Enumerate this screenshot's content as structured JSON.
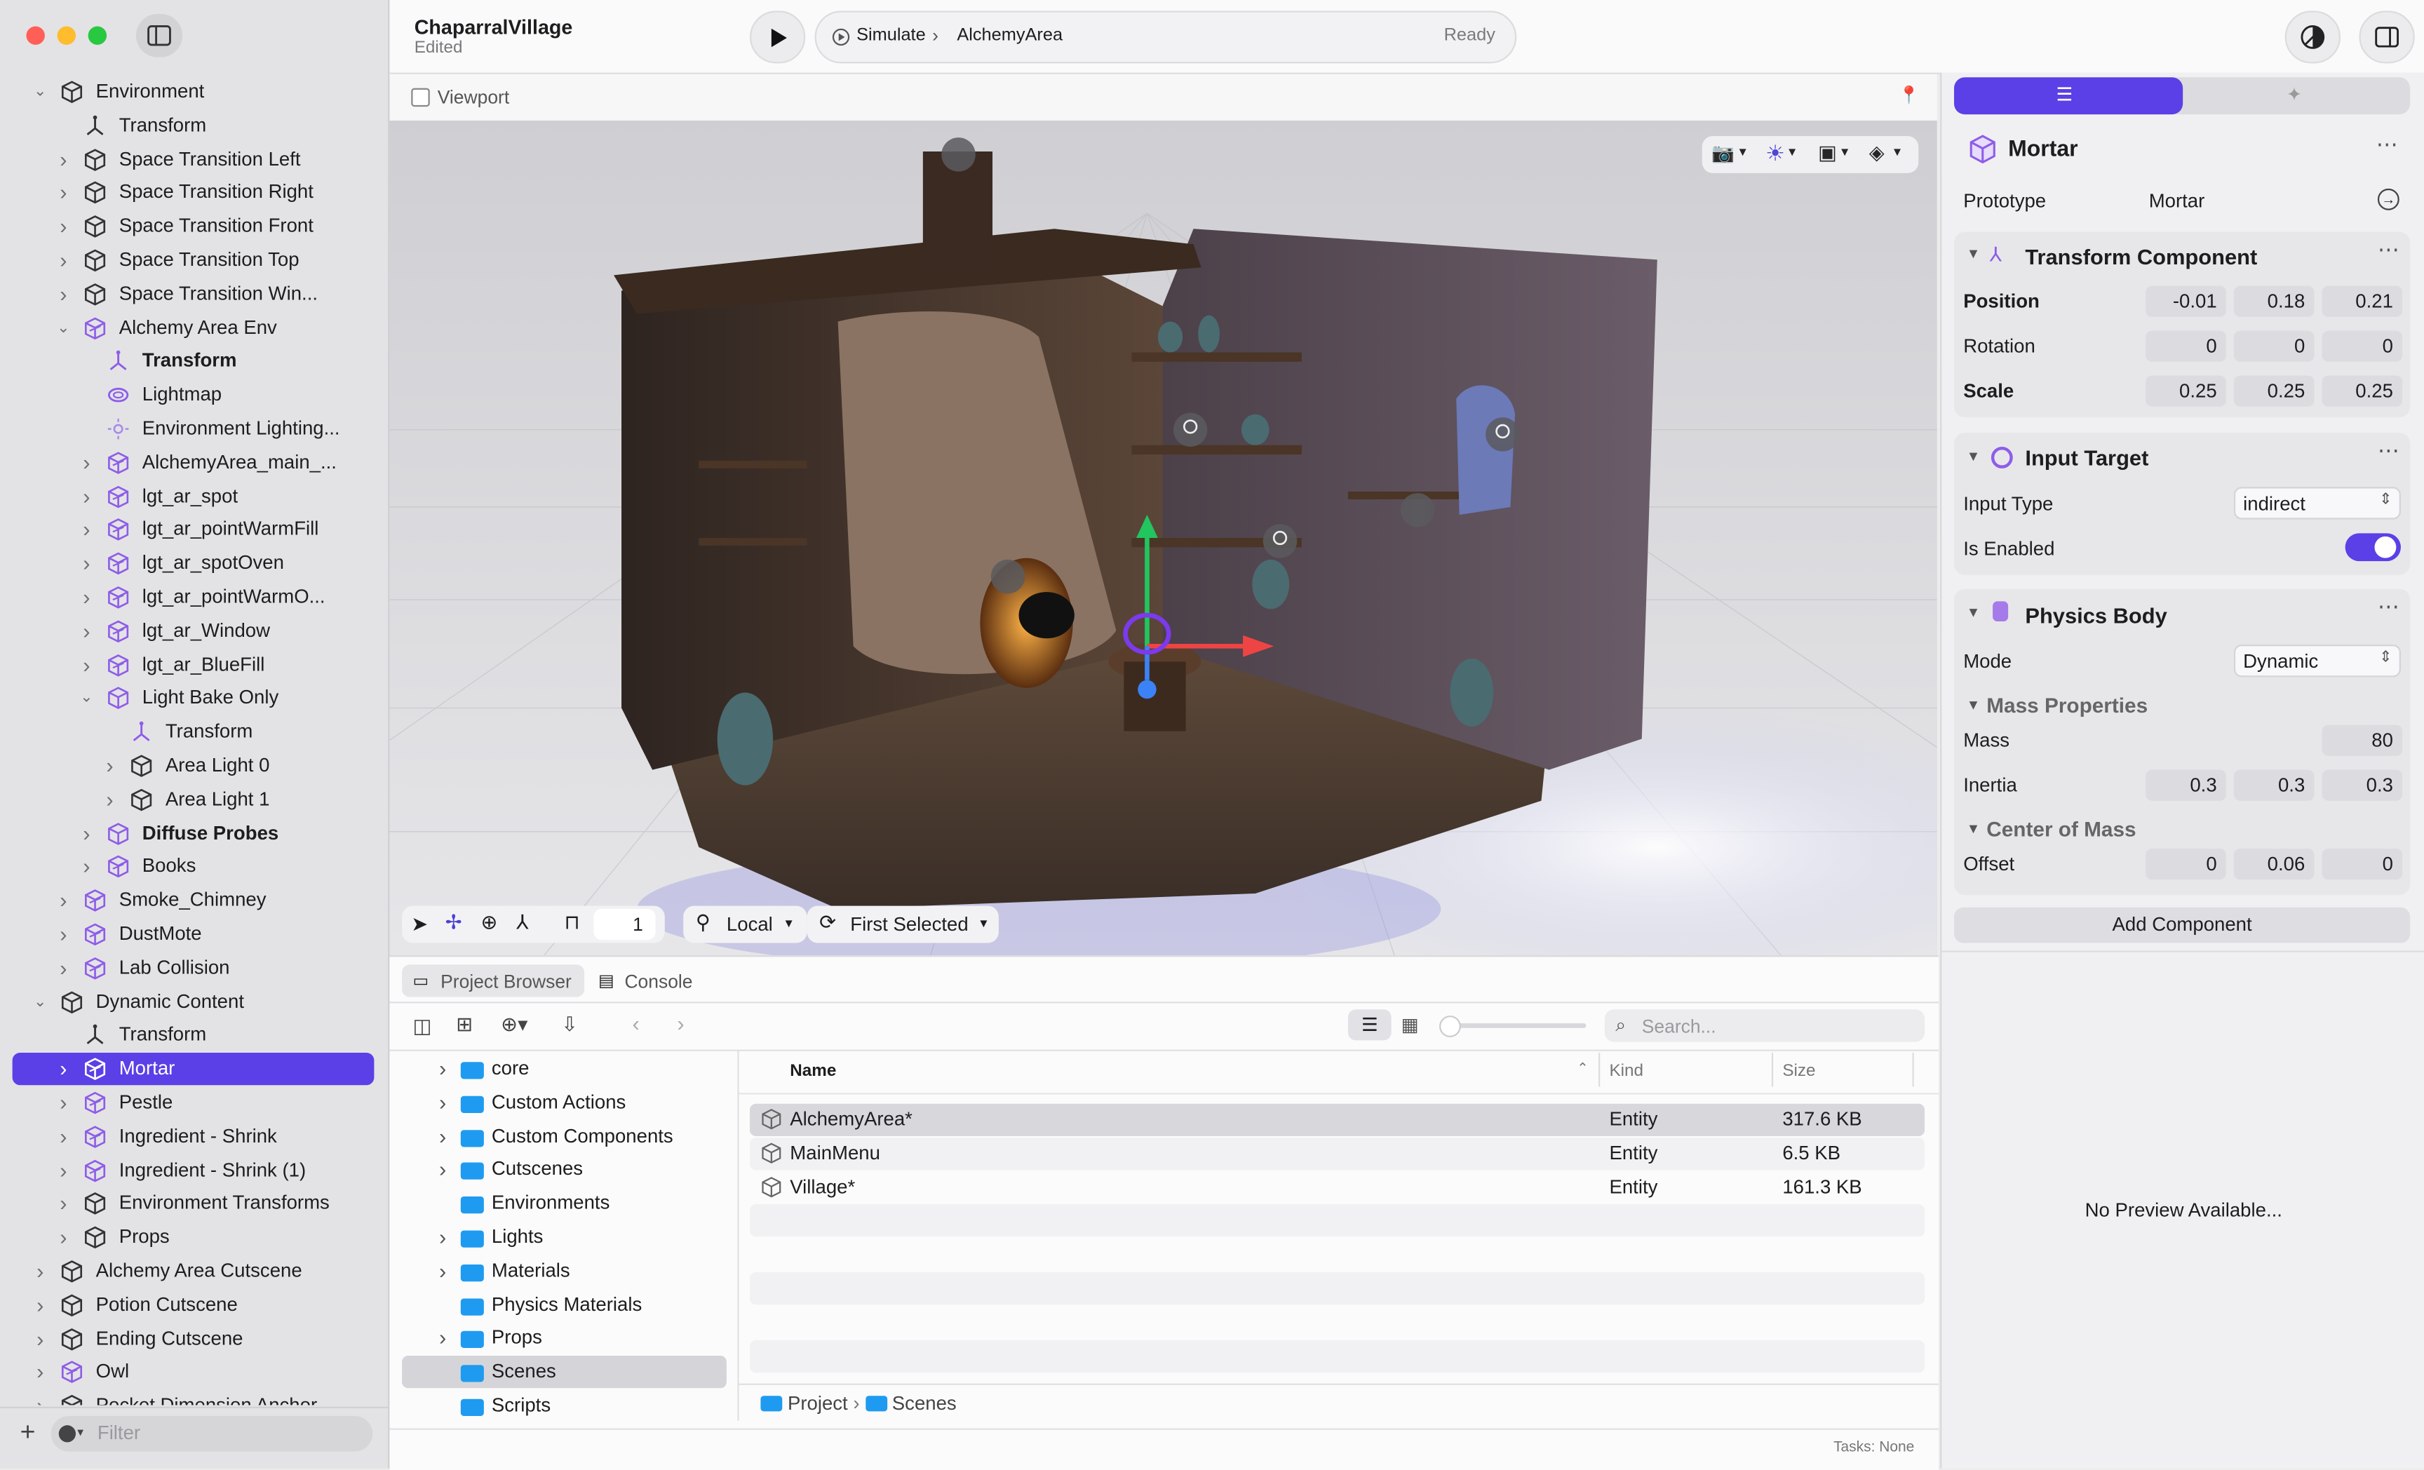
{
  "project": {
    "name": "ChaparralVillage",
    "status": "Edited"
  },
  "toolbar": {
    "simulate_label": "Simulate",
    "scene": "AlchemyArea",
    "state": "Ready"
  },
  "viewport": {
    "title": "Viewport",
    "space": "Local",
    "pivot": "First Selected",
    "snap_count": "1"
  },
  "hierarchy": [
    {
      "label": "Environment",
      "depth": 0,
      "chev": "down",
      "icon": "box"
    },
    {
      "label": "Transform",
      "depth": 1,
      "chev": "none",
      "icon": "axes"
    },
    {
      "label": "Space Transition Left",
      "depth": 1,
      "chev": "right",
      "icon": "box"
    },
    {
      "label": "Space Transition Right",
      "depth": 1,
      "chev": "right",
      "icon": "box"
    },
    {
      "label": "Space Transition Front",
      "depth": 1,
      "chev": "right",
      "icon": "box"
    },
    {
      "label": "Space Transition Top",
      "depth": 1,
      "chev": "right",
      "icon": "box"
    },
    {
      "label": "Space Transition Win...",
      "depth": 1,
      "chev": "right",
      "icon": "box"
    },
    {
      "label": "Alchemy Area Env",
      "depth": 1,
      "chev": "down",
      "icon": "proto"
    },
    {
      "label": "Transform",
      "depth": 2,
      "chev": "none",
      "icon": "axes-p",
      "bold": true
    },
    {
      "label": "Lightmap",
      "depth": 2,
      "chev": "none",
      "icon": "ring"
    },
    {
      "label": "Environment Lighting...",
      "depth": 2,
      "chev": "none",
      "icon": "sun"
    },
    {
      "label": "AlchemyArea_main_...",
      "depth": 2,
      "chev": "right",
      "icon": "proto"
    },
    {
      "label": "lgt_ar_spot",
      "depth": 2,
      "chev": "right",
      "icon": "proto"
    },
    {
      "label": "lgt_ar_pointWarmFill",
      "depth": 2,
      "chev": "right",
      "icon": "proto"
    },
    {
      "label": "lgt_ar_spotOven",
      "depth": 2,
      "chev": "right",
      "icon": "proto"
    },
    {
      "label": "lgt_ar_pointWarmO...",
      "depth": 2,
      "chev": "right",
      "icon": "proto"
    },
    {
      "label": "lgt_ar_Window",
      "depth": 2,
      "chev": "right",
      "icon": "proto"
    },
    {
      "label": "lgt_ar_BlueFill",
      "depth": 2,
      "chev": "right",
      "icon": "proto"
    },
    {
      "label": "Light Bake Only",
      "depth": 2,
      "chev": "down",
      "icon": "boxp"
    },
    {
      "label": "Transform",
      "depth": 3,
      "chev": "none",
      "icon": "axes-p"
    },
    {
      "label": "Area Light 0",
      "depth": 3,
      "chev": "right",
      "icon": "box"
    },
    {
      "label": "Area Light 1",
      "depth": 3,
      "chev": "right",
      "icon": "box"
    },
    {
      "label": "Diffuse Probes",
      "depth": 2,
      "chev": "right",
      "icon": "boxp",
      "bold": true
    },
    {
      "label": "Books",
      "depth": 2,
      "chev": "right",
      "icon": "proto"
    },
    {
      "label": "Smoke_Chimney",
      "depth": 1,
      "chev": "right",
      "icon": "proto"
    },
    {
      "label": "DustMote",
      "depth": 1,
      "chev": "right",
      "icon": "proto"
    },
    {
      "label": "Lab Collision",
      "depth": 1,
      "chev": "right",
      "icon": "proto"
    },
    {
      "label": "Dynamic Content",
      "depth": 0,
      "chev": "down",
      "icon": "box"
    },
    {
      "label": "Transform",
      "depth": 1,
      "chev": "none",
      "icon": "axes"
    },
    {
      "label": "Mortar",
      "depth": 1,
      "chev": "right",
      "icon": "proto",
      "selected": true
    },
    {
      "label": "Pestle",
      "depth": 1,
      "chev": "right",
      "icon": "proto"
    },
    {
      "label": "Ingredient - Shrink",
      "depth": 1,
      "chev": "right",
      "icon": "proto"
    },
    {
      "label": "Ingredient - Shrink (1)",
      "depth": 1,
      "chev": "right",
      "icon": "proto"
    },
    {
      "label": "Environment Transforms",
      "depth": 1,
      "chev": "right",
      "icon": "box"
    },
    {
      "label": "Props",
      "depth": 1,
      "chev": "right",
      "icon": "box"
    },
    {
      "label": "Alchemy Area Cutscene",
      "depth": 0,
      "chev": "right",
      "icon": "box"
    },
    {
      "label": "Potion Cutscene",
      "depth": 0,
      "chev": "right",
      "icon": "box"
    },
    {
      "label": "Ending Cutscene",
      "depth": 0,
      "chev": "right",
      "icon": "box"
    },
    {
      "label": "Owl",
      "depth": 0,
      "chev": "right",
      "icon": "proto"
    },
    {
      "label": "Pocket Dimension Anchor",
      "depth": 0,
      "chev": "right",
      "icon": "box"
    }
  ],
  "filter": {
    "placeholder": "Filter"
  },
  "inspector": {
    "entity_name": "Mortar",
    "prototype_label": "Prototype",
    "prototype_value": "Mortar",
    "transform": {
      "title": "Transform Component",
      "position_label": "Position",
      "position": [
        "-0.01",
        "0.18",
        "0.21"
      ],
      "rotation_label": "Rotation",
      "rotation": [
        "0",
        "0",
        "0"
      ],
      "scale_label": "Scale",
      "scale": [
        "0.25",
        "0.25",
        "0.25"
      ]
    },
    "input_target": {
      "title": "Input Target",
      "type_label": "Input Type",
      "type_value": "indirect",
      "enabled_label": "Is Enabled",
      "enabled": true
    },
    "physics": {
      "title": "Physics Body",
      "mode_label": "Mode",
      "mode_value": "Dynamic",
      "mass_props_title": "Mass Properties",
      "mass_label": "Mass",
      "mass": "80",
      "inertia_label": "Inertia",
      "inertia": [
        "0.3",
        "0.3",
        "0.3"
      ],
      "com_title": "Center of Mass",
      "offset_label": "Offset",
      "offset": [
        "0",
        "0.06",
        "0"
      ]
    },
    "add_component": "Add Component",
    "no_preview": "No Preview Available..."
  },
  "browser": {
    "tabs": [
      "Project Browser",
      "Console"
    ],
    "search_placeholder": "Search...",
    "columns": [
      "Name",
      "Kind",
      "Size"
    ],
    "folders": [
      {
        "label": "core",
        "chev": true
      },
      {
        "label": "Custom Actions",
        "chev": true
      },
      {
        "label": "Custom Components",
        "chev": true
      },
      {
        "label": "Cutscenes",
        "chev": true
      },
      {
        "label": "Environments",
        "chev": false
      },
      {
        "label": "Lights",
        "chev": true
      },
      {
        "label": "Materials",
        "chev": true
      },
      {
        "label": "Physics Materials",
        "chev": false
      },
      {
        "label": "Props",
        "chev": true
      },
      {
        "label": "Scenes",
        "chev": false,
        "selected": true
      },
      {
        "label": "Scripts",
        "chev": false
      }
    ],
    "files": [
      {
        "name": "AlchemyArea*",
        "kind": "Entity",
        "size": "317.6 KB",
        "selected": true
      },
      {
        "name": "MainMenu",
        "kind": "Entity",
        "size": "6.5 KB"
      },
      {
        "name": "Village*",
        "kind": "Entity",
        "size": "161.3 KB"
      }
    ],
    "path": [
      "Project",
      "Scenes"
    ],
    "tasks": "Tasks: None"
  },
  "colors": {
    "accent": "#5a40e6",
    "folder": "#1e9bf0",
    "proto": "#8e5de8"
  }
}
